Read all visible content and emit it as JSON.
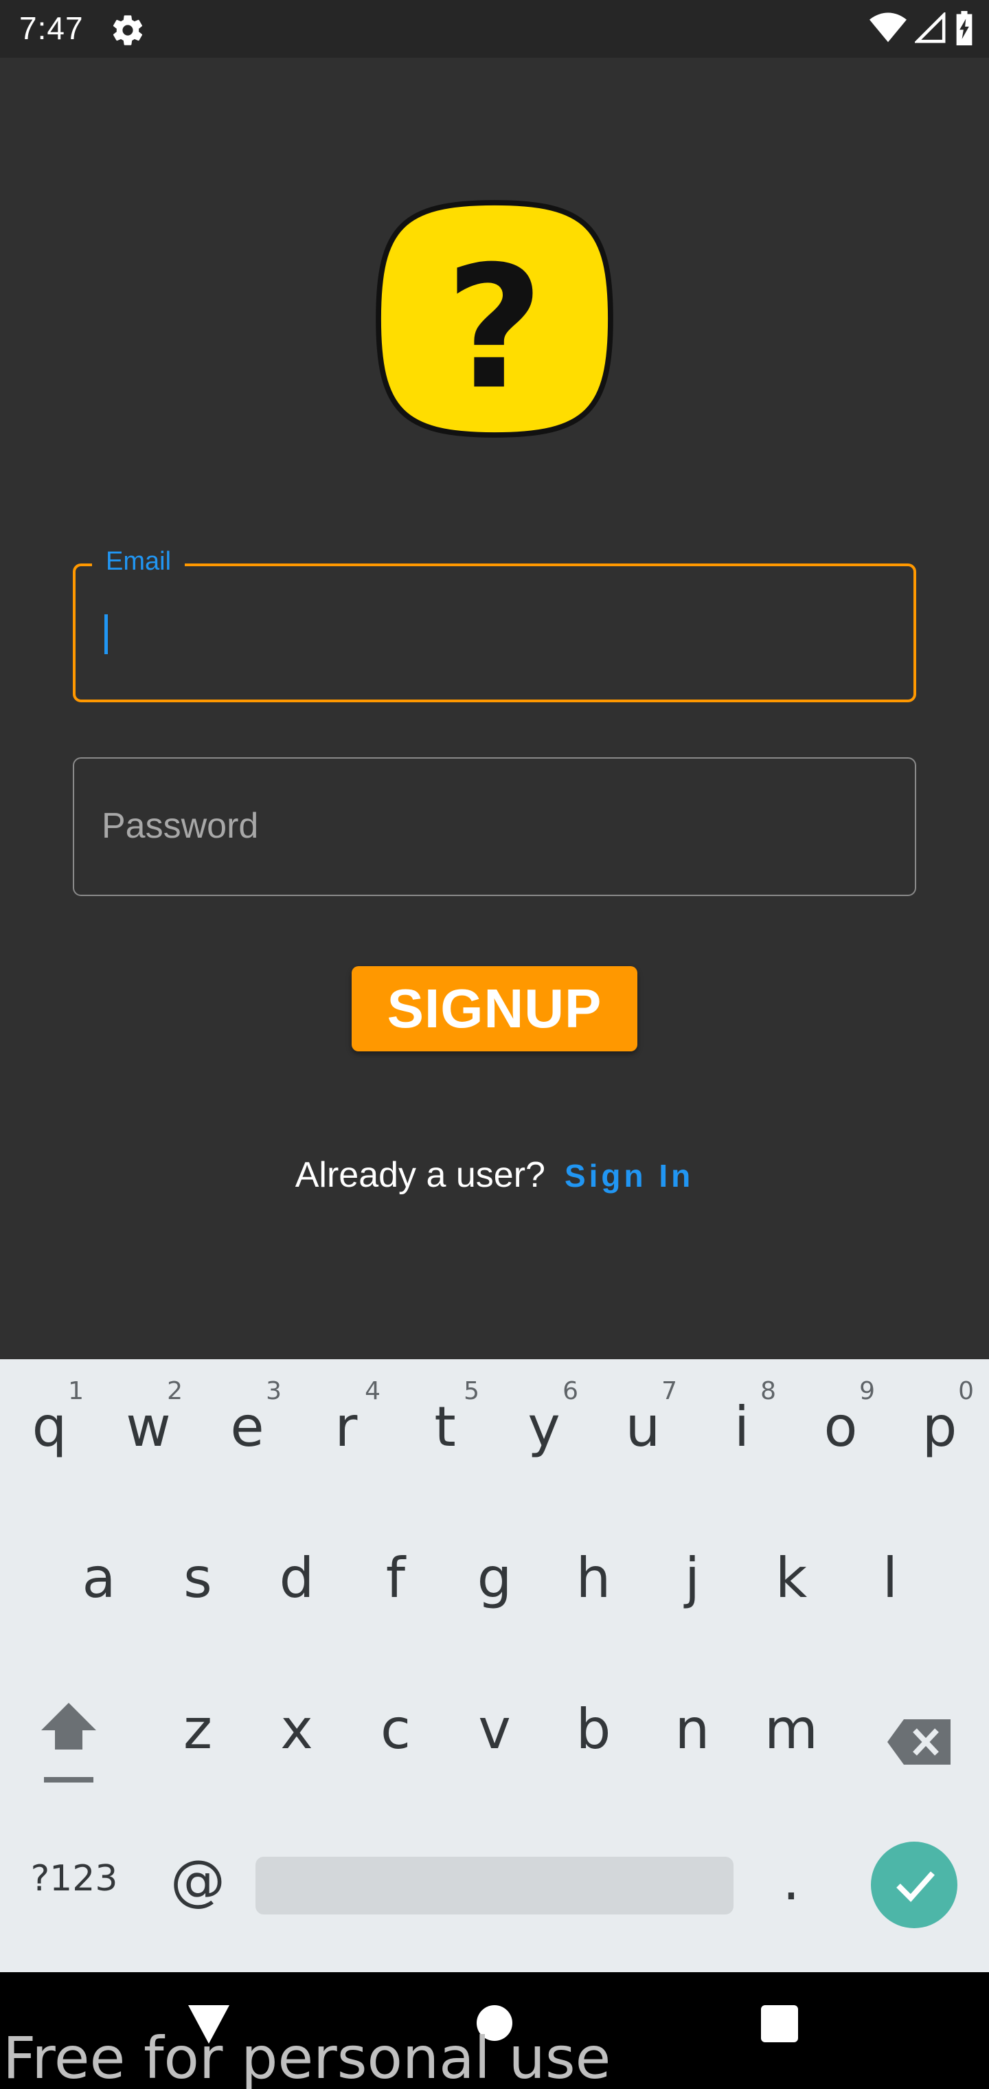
{
  "status_bar": {
    "time": "7:47",
    "icons": [
      "settings-gear-icon",
      "wifi-icon",
      "cell-signal-icon",
      "battery-charging-icon"
    ]
  },
  "form": {
    "email_label": "Email",
    "email_value": "",
    "password_placeholder": "Password",
    "signup_label": "SIGNUP",
    "already_user_text": "Already a user?",
    "signin_link": "Sign In"
  },
  "keyboard": {
    "row1": [
      {
        "ch": "q",
        "num": "1"
      },
      {
        "ch": "w",
        "num": "2"
      },
      {
        "ch": "e",
        "num": "3"
      },
      {
        "ch": "r",
        "num": "4"
      },
      {
        "ch": "t",
        "num": "5"
      },
      {
        "ch": "y",
        "num": "6"
      },
      {
        "ch": "u",
        "num": "7"
      },
      {
        "ch": "i",
        "num": "8"
      },
      {
        "ch": "o",
        "num": "9"
      },
      {
        "ch": "p",
        "num": "0"
      }
    ],
    "row2": [
      "a",
      "s",
      "d",
      "f",
      "g",
      "h",
      "j",
      "k",
      "l"
    ],
    "row3": [
      "z",
      "x",
      "c",
      "v",
      "b",
      "n",
      "m"
    ],
    "symbols_key": "?123",
    "at_key": "@",
    "period_key": "."
  },
  "watermark": "Free for personal use",
  "colors": {
    "background": "#303030",
    "accent_orange": "#ff9800",
    "link_blue": "#2196f3",
    "logo_yellow": "#ffdd00",
    "enter_teal": "#4db6a8"
  }
}
